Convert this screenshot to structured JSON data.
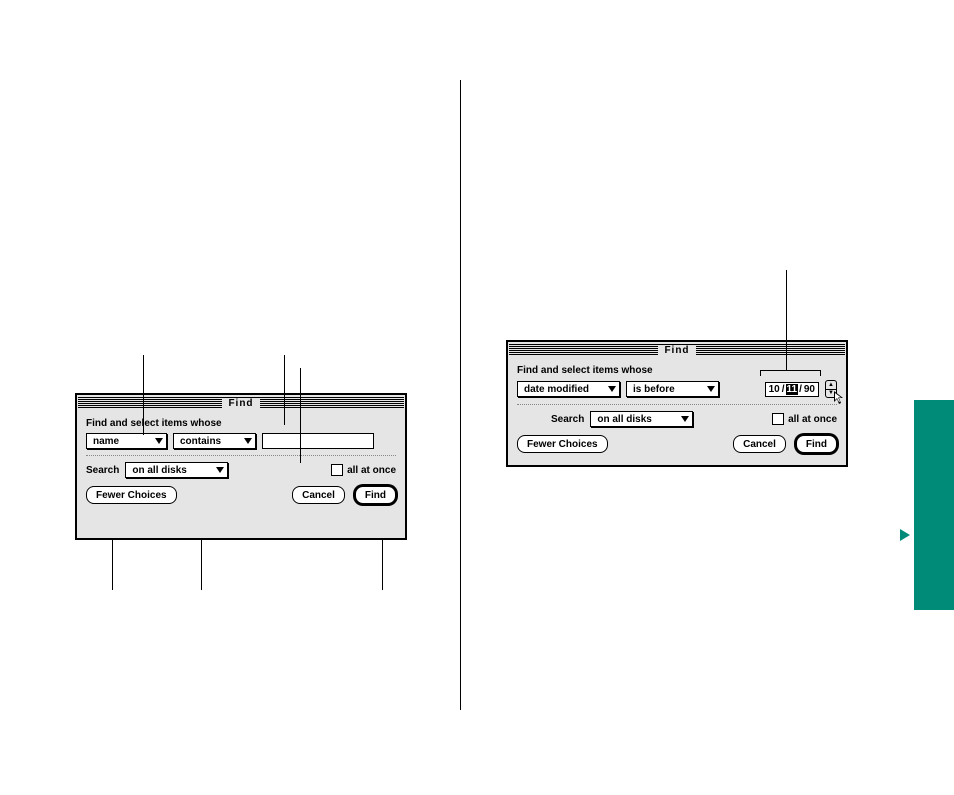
{
  "left_dialog": {
    "title": "Find",
    "prompt": "Find and select items whose",
    "attribute_popup": "name",
    "operator_popup": "contains",
    "value_input": "",
    "search_label": "Search",
    "scope_popup": "on all disks",
    "all_at_once_label": "all at once",
    "fewer_choices_btn": "Fewer Choices",
    "cancel_btn": "Cancel",
    "find_btn": "Find"
  },
  "right_dialog": {
    "title": "Find",
    "prompt": "Find and select items whose",
    "attribute_popup": "date modified",
    "operator_popup": "is before",
    "date_month": "10",
    "date_sep1": "/",
    "date_day": "11",
    "date_sep2": "/",
    "date_year": "90",
    "search_label": "Search",
    "scope_popup": "on all disks",
    "all_at_once_label": "all at once",
    "fewer_choices_btn": "Fewer Choices",
    "cancel_btn": "Cancel",
    "find_btn": "Find"
  }
}
